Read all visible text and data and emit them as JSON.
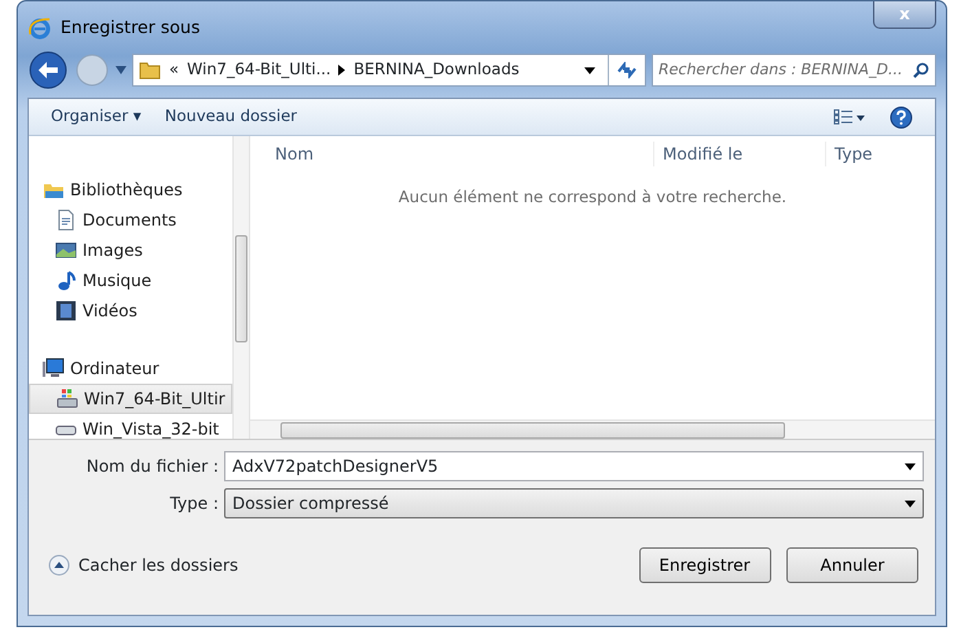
{
  "window": {
    "title": "Enregistrer sous",
    "close": "x"
  },
  "address": {
    "overflow": "«",
    "crumbs": [
      "Win7_64-Bit_Ulti...",
      "BERNINA_Downloads"
    ]
  },
  "search": {
    "placeholder": "Rechercher dans : BERNINA_D..."
  },
  "toolbar": {
    "items": [
      "Organiser ▾",
      "Nouveau dossier"
    ]
  },
  "sidebar": {
    "items": [
      {
        "label": "Bibliothèques",
        "kind": "library",
        "selected": false,
        "children": [
          {
            "label": "Documents",
            "kind": "document",
            "selected": false
          },
          {
            "label": "Images",
            "kind": "image",
            "selected": false
          },
          {
            "label": "Musique",
            "kind": "music",
            "selected": false
          },
          {
            "label": "Vidéos",
            "kind": "video",
            "selected": false
          }
        ]
      },
      {
        "label": "Ordinateur",
        "kind": "computer",
        "selected": false,
        "children": [
          {
            "label": "Win7_64-Bit_Ultir",
            "kind": "system",
            "selected": true
          },
          {
            "label": "Win_Vista_32-bit",
            "kind": "drive",
            "selected": false
          }
        ]
      }
    ]
  },
  "table": {
    "columns": [
      "Nom",
      "Modifié le",
      "Type"
    ],
    "empty_message": "Aucun élément ne correspond à votre recherche."
  },
  "form": {
    "fields": [
      {
        "label": "Nom du fichier :",
        "value": "AdxV72patchDesignerV5",
        "kind": "combo"
      },
      {
        "label": "Type :",
        "value": "Dossier compressé",
        "kind": "select"
      }
    ]
  },
  "footer": {
    "toggle": "Cacher les dossiers",
    "buttons": [
      "Enregistrer",
      "Annuler"
    ]
  }
}
